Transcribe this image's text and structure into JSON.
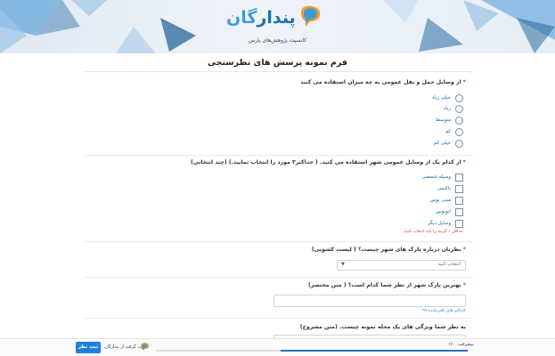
{
  "header": {
    "logo_main": "پندار",
    "logo_sub": "گان",
    "tagline": "کانسپت پژوهش‌های پارس"
  },
  "page": {
    "title": "فرم نمونه پرسش های نظرسنجی"
  },
  "questions": {
    "q1": {
      "text": "از وسایل حمل و نقل عمومی به چه میزان استفاده می کنید",
      "required": true,
      "options": [
        "خیلی زیاد",
        "زیاد",
        "متوسط",
        "کم",
        "خیلی کم"
      ]
    },
    "q2": {
      "text": "از کدام یک از وسایل عمومی شهر استفاده می کنید. ( حداکثر۳ مورد را انتخاب نمایید.) (چند انتخابی)",
      "required": true,
      "options": [
        "وسیله شخصی",
        "تاکسی",
        "مینی بوس",
        "اتوبوس",
        "وسایل دیگر"
      ],
      "error": "حداقل ۱ گزینه را باید انتخاب کنید."
    },
    "q3": {
      "text": "نظرتان درباره پارک های شهر چیست؟ ( لیست کشویی)",
      "required": true,
      "select_value": "انتخاب کنید"
    },
    "q4": {
      "text": "بهترین پارک شهر از نظر شما کدام است؟ ( متن مختصر)",
      "required": true,
      "hint": "کاراکتر های باقی‌مانده:۹۹"
    },
    "q5": {
      "text": "به نظر شما ویژگی های یک محله نمونه چیست. (متن مشروح)",
      "required": false
    }
  },
  "footer": {
    "submit_label": "ثبت نظر",
    "powered_by": "قدرت گرفته از پندارگان",
    "progress_label": "پیشرفت: ۱۶۰",
    "progress_value": 0.6
  },
  "colors": {
    "accent": "#1e7fe0",
    "error": "#e53935",
    "link": "#0c6aa6",
    "brand_orange": "#f59a2b"
  }
}
